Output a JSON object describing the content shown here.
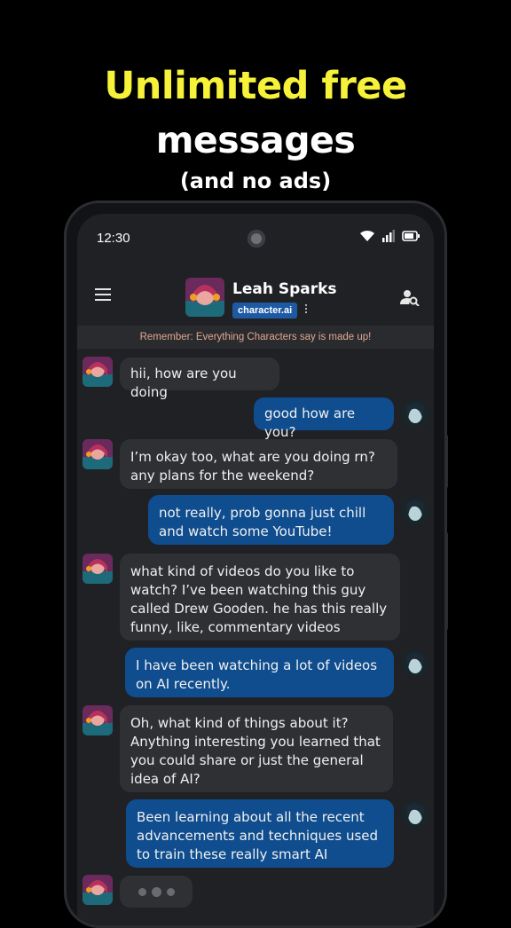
{
  "promo": {
    "line1": "Unlimited free",
    "line2": "messages",
    "line3": "(and no ads)"
  },
  "status_bar": {
    "time": "12:30"
  },
  "header": {
    "character_name": "Leah Sparks",
    "brand": "character.ai"
  },
  "notice": "Remember: Everything Characters say is made up!",
  "messages": [
    {
      "from": "bot",
      "text": "hii, how are you doing"
    },
    {
      "from": "user",
      "text": "good how are you?"
    },
    {
      "from": "bot",
      "text": "I’m okay too, what are you doing rn? any plans for the weekend?"
    },
    {
      "from": "user",
      "text": "not really, prob gonna just chill and watch some YouTube!"
    },
    {
      "from": "bot",
      "text": "what kind of videos do you like to watch? I’ve been watching this guy called Drew Gooden. he has this really funny, like, commentary videos"
    },
    {
      "from": "user",
      "text": "I have been watching a lot of videos on AI recently."
    },
    {
      "from": "bot",
      "text": "Oh, what kind of things about it? Anything interesting you learned that you could share or just the general idea of AI?"
    },
    {
      "from": "user",
      "text": "Been learning about all the recent advancements and techniques used to train these really smart AI"
    }
  ],
  "colors": {
    "promo_yellow": "#f6f23a",
    "user_bubble": "#0f4d8f",
    "bot_bubble": "#2f3034",
    "brand_badge": "#1d5aa3",
    "notice_text": "#e0a88e"
  },
  "icons": [
    "menu-icon",
    "more-icon",
    "user-search-icon",
    "wifi-icon",
    "signal-icon",
    "battery-icon"
  ]
}
